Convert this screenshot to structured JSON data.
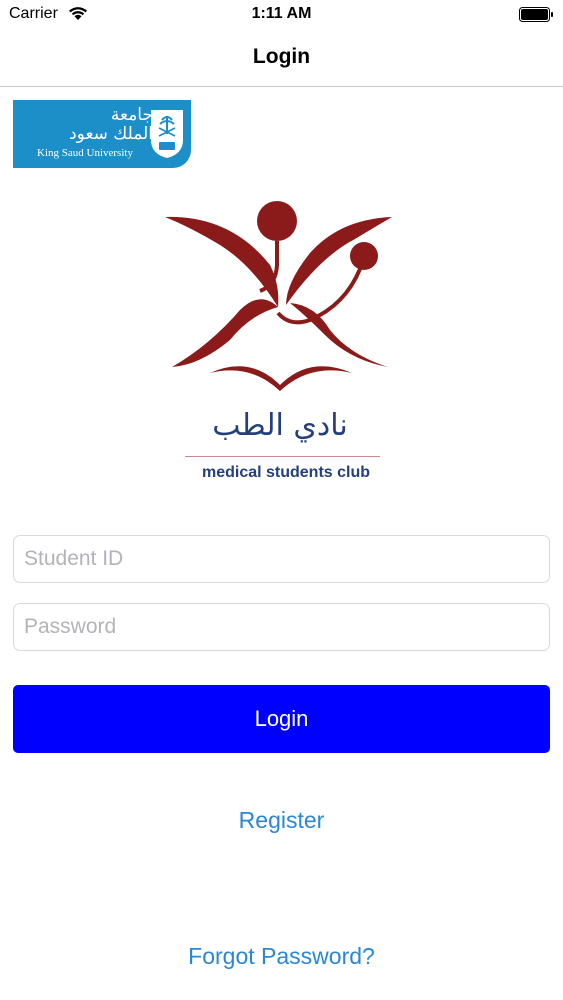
{
  "status_bar": {
    "carrier": "Carrier",
    "time": "1:11 AM",
    "wifi_icon": "wifi-icon",
    "battery_icon": "battery-icon"
  },
  "nav": {
    "title": "Login"
  },
  "ksu_logo": {
    "arabic_line1": "جامعة",
    "arabic_line2": "الملك سعود",
    "english": "King Saud University",
    "color": "#1c8ec8"
  },
  "club_logo": {
    "arabic_name": "نادي الطب",
    "english_name": "medical students club",
    "icon_color": "#8b1a1a",
    "text_color": "#243f7a"
  },
  "form": {
    "student_id_placeholder": "Student ID",
    "password_placeholder": "Password",
    "login_label": "Login",
    "login_color": "#0000ff"
  },
  "links": {
    "register": "Register",
    "forgot_password": "Forgot Password?",
    "color": "#2a87d6"
  }
}
